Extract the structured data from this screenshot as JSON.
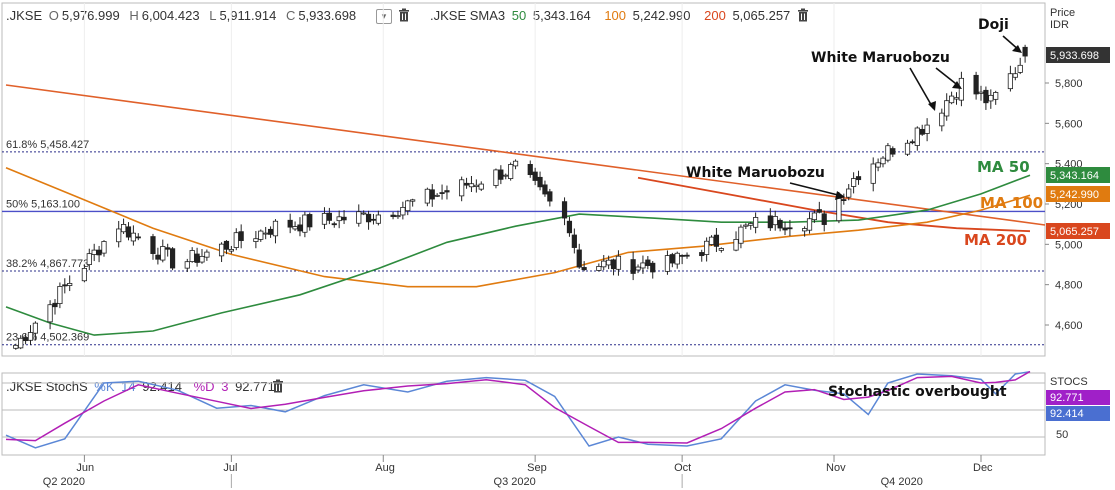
{
  "header": {
    "symbol": ".JKSE",
    "ohlc": [
      {
        "k": "O",
        "v": "5,976.999"
      },
      {
        "k": "H",
        "v": "6,004.423"
      },
      {
        "k": "L",
        "v": "5,911.914"
      },
      {
        "k": "C",
        "v": "5,933.698"
      }
    ],
    "sma_label": ".JKSE SMA3",
    "sma": [
      {
        "period": "50",
        "value": "5,343.164",
        "color": "#2e8b3e"
      },
      {
        "period": "100",
        "value": "5,242.990",
        "color": "#e07b10"
      },
      {
        "period": "200",
        "value": "5,065.257",
        "color": "#d9471e"
      }
    ],
    "stoch_label": ".JKSE StochS",
    "stoch_k_label": "%K",
    "stoch_k_period": "14",
    "stoch_k_value": "92.414",
    "stoch_d_label": "%D",
    "stoch_d_period": "3",
    "stoch_d_value": "92.771"
  },
  "axis": {
    "price_title_1": "Price",
    "price_title_2": "IDR",
    "price_ticks": [
      "5,800",
      "5,600",
      "5,400",
      "5,200",
      "5,000",
      "4,800",
      "4,600"
    ],
    "stoch_title": "STOCS",
    "stoch_ticks": [
      "50"
    ],
    "month_labels": [
      "Jun",
      "Jul",
      "Aug",
      "Sep",
      "Oct",
      "Nov",
      "Dec"
    ],
    "quarter_labels": [
      "Q2 2020",
      "Q3 2020",
      "Q4 2020"
    ]
  },
  "badges": {
    "last_price": "5,933.698",
    "ma50": "5,343.164",
    "ma100": "5,242.990",
    "ma200": "5,065.257",
    "stoch_d": "92.771",
    "stoch_k": "92.414"
  },
  "annotations": {
    "doji": "Doji",
    "white_maruobozu_1": "White Maruobozu",
    "white_maruobozu_2": "White Maruobozu",
    "ma50": "MA 50",
    "ma100": "MA 100",
    "ma200": "MA 200",
    "stoch_overbought": "Stochastic overbought"
  },
  "fib_levels": [
    {
      "label": "61.8%",
      "value": "5,458.427"
    },
    {
      "label": "50%",
      "value": "5,163.100"
    },
    {
      "label": "38.2%",
      "value": "4,867.773"
    },
    {
      "label": "23.6%",
      "value": "4,502.369"
    }
  ],
  "colors": {
    "up_candle": "#ffffff",
    "down_candle": "#222222",
    "ma50": "#2e8b3e",
    "ma100": "#e07b10",
    "ma200": "#d9471e",
    "trend_line": "#e0602a",
    "fib_line": "#2b2f8a",
    "fib50_line": "#4b4fc8",
    "stoch_k": "#5b87d6",
    "stoch_d": "#b21fb5",
    "price_badge": "#333333",
    "stoch_d_badge": "#a020c8",
    "stoch_k_badge": "#4a6fd1"
  },
  "chart_data": {
    "type": "candlestick",
    "symbol": ".JKSE",
    "xlabels": [
      "Jun",
      "Jul",
      "Aug",
      "Sep",
      "Oct",
      "Nov",
      "Dec"
    ],
    "ylim": [
      4450,
      6050
    ],
    "last_close": 5933.698,
    "ohlc_key_points": [
      {
        "date": "2020-05-18",
        "close": 4500
      },
      {
        "date": "2020-06-08",
        "close": 5100
      },
      {
        "date": "2020-06-20",
        "close": 4900
      },
      {
        "date": "2020-07-10",
        "close": 5090
      },
      {
        "date": "2020-07-31",
        "close": 5150
      },
      {
        "date": "2020-08-28",
        "close": 5380
      },
      {
        "date": "2020-09-08",
        "close": 5100
      },
      {
        "date": "2020-09-10",
        "close": 4900
      },
      {
        "date": "2020-09-28",
        "close": 4900
      },
      {
        "date": "2020-10-16",
        "close": 5100
      },
      {
        "date": "2020-10-30",
        "close": 5130
      },
      {
        "date": "2020-11-06",
        "close": 5360
      },
      {
        "date": "2020-11-20",
        "close": 5600
      },
      {
        "date": "2020-11-27",
        "close": 5800
      },
      {
        "date": "2020-12-03",
        "close": 5700
      },
      {
        "date": "2020-12-10",
        "close": 5933.698
      }
    ],
    "series": [
      {
        "name": "50",
        "last": 5343.164
      },
      {
        "name": "100",
        "last": 5242.99
      },
      {
        "name": "200",
        "last": 5065.257
      }
    ],
    "stochastic": {
      "k_period": 14,
      "d_period": 3,
      "k": 92.414,
      "d": 92.771
    }
  }
}
